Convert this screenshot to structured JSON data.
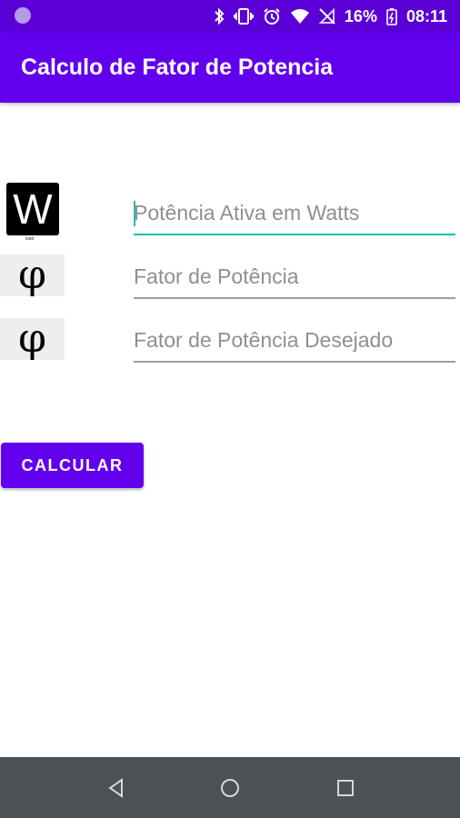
{
  "status_bar": {
    "battery": "16%",
    "time": "08:11",
    "icons": [
      "notification-dot-icon",
      "bluetooth-icon",
      "vibrate-icon",
      "alarm-icon",
      "wifi-icon",
      "no-signal-icon",
      "battery-icon"
    ]
  },
  "app_bar": {
    "title": "Calculo de Fator de Potencia"
  },
  "form": {
    "rows": [
      {
        "icon_text": "W",
        "icon_caption": "watt",
        "placeholder": "Potência Ativa em Watts",
        "value": ""
      },
      {
        "icon_text": "φ",
        "placeholder": "Fator de Potência",
        "value": ""
      },
      {
        "icon_text": "φ",
        "placeholder": "Fator de Potência Desejado",
        "value": ""
      }
    ],
    "button_label": "CALCULAR"
  },
  "nav_bar": {
    "buttons": [
      "back-icon",
      "home-icon",
      "recents-icon"
    ]
  },
  "colors": {
    "primary": "#6200ee",
    "status": "#5a00d6",
    "accent": "#1fbfb0"
  }
}
